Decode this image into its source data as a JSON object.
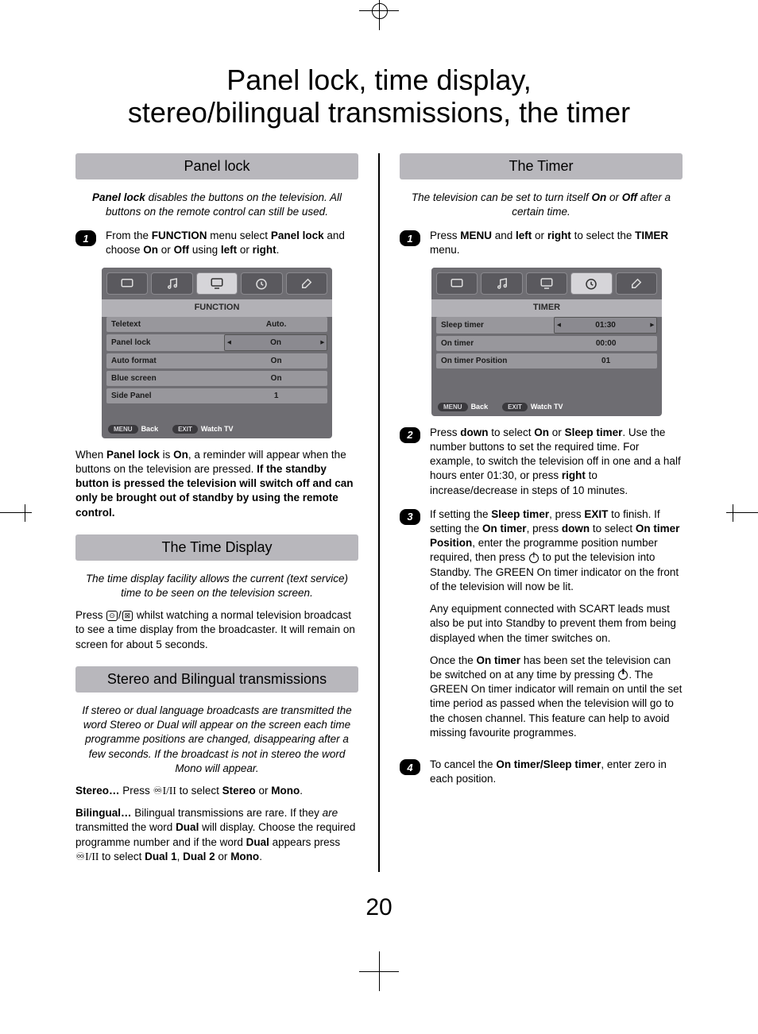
{
  "page_title_line1": "Panel lock, time display,",
  "page_title_line2": "stereo/bilingual transmissions, the timer",
  "page_number": "20",
  "left": {
    "panel_lock": {
      "heading": "Panel lock",
      "intro_pre": "Panel lock",
      "intro_post": " disables the buttons on the television. All buttons on the remote control can still be used.",
      "step1_pre": "From the ",
      "step1_b1": "FUNCTION",
      "step1_mid": " menu select ",
      "step1_b2": "Panel lock",
      "step1_mid2": " and choose ",
      "step1_b3": "On",
      "step1_or": " or ",
      "step1_b4": "Off",
      "step1_using": " using ",
      "step1_b5": "left",
      "step1_or2": " or ",
      "step1_b6": "right",
      "step1_end": ".",
      "after1": "When ",
      "after_b1": "Panel lock",
      "after2": " is ",
      "after_b2": "On",
      "after3": ", a reminder will appear when the buttons on the television are pressed. ",
      "after_b3": "If the standby button is pressed the television will switch off and can only be brought out of standby by using the remote control."
    },
    "time_display": {
      "heading": "The Time Display",
      "intro": "The time display facility allows the current (text service) time to be seen on the television screen.",
      "body_pre": "Press ",
      "body_post": " whilst watching a normal television broadcast to see a time display from the broadcaster. It will remain on screen for about 5 seconds."
    },
    "stereo": {
      "heading": "Stereo and Bilingual transmissions",
      "intro": "If stereo or dual language broadcasts are transmitted the word Stereo or Dual will appear on the screen each time programme positions are changed, disappearing after a few seconds. If the broadcast is not in stereo the word Mono will appear.",
      "s_lead": "Stereo…",
      "s_pre": " Press ",
      "s_glyph": "♾I/II",
      "s_mid": " to select ",
      "s_b1": "Stereo",
      "s_or": " or ",
      "s_b2": "Mono",
      "s_end": ".",
      "b_lead": "Bilingual…",
      "b_1": " Bilingual transmissions are rare. If they ",
      "b_i": "are",
      "b_2": " transmitted the word ",
      "b_b1": "Dual",
      "b_3": " will display. Choose the required programme number and if the word ",
      "b_b2": "Dual",
      "b_4": " appears press ",
      "b_glyph": "♾I/II",
      "b_5": " to select ",
      "b_b3": "Dual 1",
      "b_c1": ", ",
      "b_b4": "Dual 2",
      "b_or": " or ",
      "b_b5": "Mono",
      "b_end": "."
    },
    "osd": {
      "title": "FUNCTION",
      "rows": [
        {
          "label": "Teletext",
          "value": "Auto."
        },
        {
          "label": "Panel lock",
          "value": "On",
          "selected": true
        },
        {
          "label": "Auto format",
          "value": "On"
        },
        {
          "label": "Blue screen",
          "value": "On"
        },
        {
          "label": "Side Panel",
          "value": "1"
        }
      ],
      "back_pill": "MENU",
      "back_label": "Back",
      "exit_pill": "EXIT",
      "exit_label": "Watch TV"
    }
  },
  "right": {
    "timer": {
      "heading": "The Timer",
      "intro_pre": "The television can be set to turn itself ",
      "intro_b1": "On",
      "intro_or": " or ",
      "intro_b2": "Off",
      "intro_post": " after a certain time.",
      "s1_pre": "Press ",
      "s1_b1": "MENU",
      "s1_mid": " and ",
      "s1_b2": "left",
      "s1_or": " or ",
      "s1_b3": "right",
      "s1_mid2": " to select the ",
      "s1_b4": "TIMER",
      "s1_end": " menu.",
      "s2_pre": "Press ",
      "s2_b1": "down",
      "s2_mid": " to select ",
      "s2_b2": "On",
      "s2_or": " or ",
      "s2_b3": "Sleep timer",
      "s2_mid2": ". Use the number buttons to set the required time. For example, to switch the television off in one and a half hours enter 01:30, or press ",
      "s2_b4": "right",
      "s2_end": " to increase/decrease in steps of 10 minutes.",
      "s3_pre": "If setting the ",
      "s3_b1": "Sleep timer",
      "s3_mid": ", press ",
      "s3_b2": "EXIT",
      "s3_mid2": " to finish. If setting the ",
      "s3_b3": "On timer",
      "s3_mid3": ", press ",
      "s3_b4": "down",
      "s3_mid4": " to select ",
      "s3_b5": "On timer Position",
      "s3_mid5": ", enter the programme position number required, then press ",
      "s3_end": " to put the television into Standby. The GREEN On timer indicator on the front of the television will now be lit.",
      "s3_p2": "Any equipment connected with SCART leads must also be put into Standby to prevent them from being displayed when the timer switches on.",
      "s3_p3_pre": "Once the ",
      "s3_p3_b1": "On timer",
      "s3_p3_mid": " has been set the television can be switched on at any time by pressing ",
      "s3_p3_end": ". The GREEN On timer indicator will remain on until the set time period as passed when the television will go to the chosen channel. This feature can help to avoid missing favourite programmes.",
      "s4_pre": "To cancel the ",
      "s4_b1": "On timer/Sleep timer",
      "s4_end": ", enter zero in each position."
    },
    "osd": {
      "title": "TIMER",
      "rows": [
        {
          "label": "Sleep timer",
          "value": "01:30",
          "selected": true
        },
        {
          "label": "On timer",
          "value": "00:00"
        },
        {
          "label": "On timer Position",
          "value": "01"
        }
      ],
      "back_pill": "MENU",
      "back_label": "Back",
      "exit_pill": "EXIT",
      "exit_label": "Watch TV"
    }
  }
}
